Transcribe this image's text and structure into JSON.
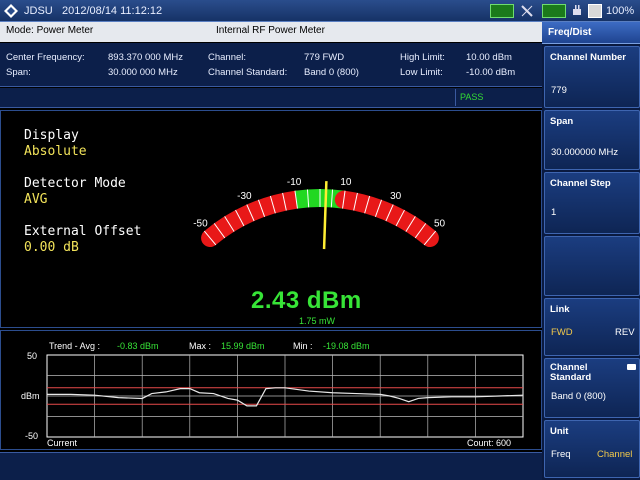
{
  "titlebar": {
    "brand": "JDSU",
    "datetime": "2012/08/14 11:12:12",
    "battery": "100%"
  },
  "header": {
    "mode": "Mode: Power Meter",
    "title": "Internal RF Power Meter"
  },
  "info": {
    "center_freq_label": "Center Frequency:",
    "center_freq_value": "893.370 000 MHz",
    "span_label": "Span:",
    "span_value": "30.000 000 MHz",
    "channel_label": "Channel:",
    "channel_value": "779 FWD",
    "standard_label": "Channel Standard:",
    "standard_value": "Band 0 (800)",
    "high_limit_label": "High Limit:",
    "high_limit_value": "10.00 dBm",
    "low_limit_label": "Low Limit:",
    "low_limit_value": "-10.00 dBm"
  },
  "status": {
    "pass": "PASS"
  },
  "meter": {
    "display_label": "Display",
    "display_value": "Absolute",
    "detector_label": "Detector Mode",
    "detector_value": "AVG",
    "offset_label": "External Offset",
    "offset_value": "0.00 dB",
    "scale_labels": [
      "-50",
      "-30",
      "-10",
      "10",
      "30",
      "50"
    ],
    "scale_values": [
      -50,
      -30,
      -10,
      10,
      30,
      50
    ],
    "range_min": -50,
    "range_max": 50,
    "pass_low": -10,
    "pass_high": 10,
    "needle_value": 2.43,
    "reading": "2.43 dBm",
    "reading_mw": "1.75 mW",
    "colors": {
      "fail": "#e81818",
      "pass": "#22d822",
      "needle": "#ffee33"
    }
  },
  "trend": {
    "avg_label": "Trend - Avg :",
    "avg_value": "-0.83 dBm",
    "max_label": "Max :",
    "max_value": "15.99 dBm",
    "min_label": "Min :",
    "min_value": "-19.08 dBm",
    "ytop": "50",
    "ymid": "dBm",
    "ybottom": "-50",
    "current_label": "Current",
    "count_label": "Count: 600",
    "chart_data": {
      "type": "line",
      "ylim": [
        -50,
        50
      ],
      "limits": [
        10,
        -10
      ],
      "x": [
        0,
        5,
        10,
        15,
        20,
        22,
        25,
        28,
        30,
        32,
        35,
        38,
        40,
        42,
        44,
        46,
        48,
        50,
        55,
        60,
        65,
        70,
        72,
        74,
        76,
        78,
        80,
        85,
        90,
        95,
        100
      ],
      "values": [
        2,
        2,
        1,
        -2,
        -3,
        3,
        5,
        9,
        9,
        4,
        3,
        -3,
        -5,
        -12,
        -12,
        9,
        10,
        10,
        6,
        4,
        3,
        2,
        0,
        -3,
        -7,
        -3,
        -2,
        -1,
        -1,
        0,
        1
      ]
    }
  },
  "rpanel": {
    "title": "Freq/Dist",
    "channel_number_title": "Channel Number",
    "channel_number_value": "779",
    "span_title": "Span",
    "span_value": "30.000000 MHz",
    "channel_step_title": "Channel Step",
    "channel_step_value": "1",
    "link_title": "Link",
    "link_fwd": "FWD",
    "link_rev": "REV",
    "standard_title_1": "Channel",
    "standard_title_2": "Standard",
    "standard_value": "Band 0 (800)",
    "unit_title": "Unit",
    "unit_freq": "Freq",
    "unit_channel": "Channel"
  }
}
